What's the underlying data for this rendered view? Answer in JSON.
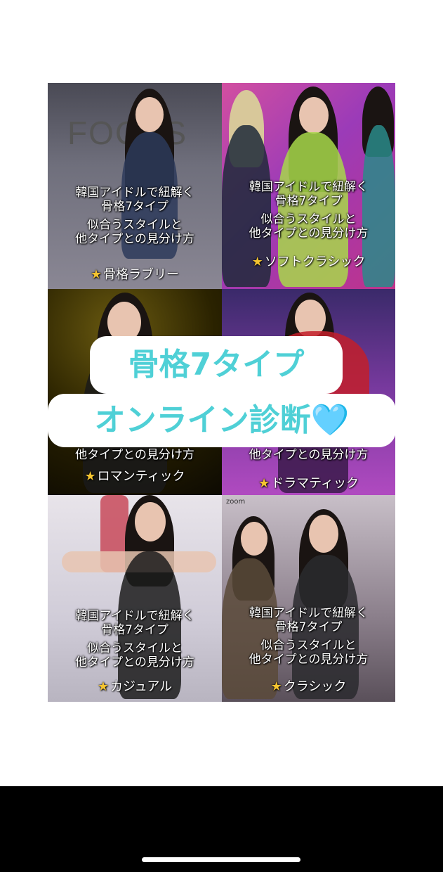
{
  "tiles": [
    {
      "caption": [
        "韓国アイドルで紐解く",
        "骨格7タイプ",
        "似合うスタイルと",
        "他タイプとの見分け方"
      ],
      "tag": "骨格ラブリー",
      "bg_logo": "FOCUS"
    },
    {
      "caption": [
        "韓国アイドルで紐解く",
        "骨格7タイプ",
        "似合うスタイルと",
        "他タイプとの見分け方"
      ],
      "tag": "ソフトクラシック"
    },
    {
      "caption_partial": "他タイプとの見分け方",
      "tag": "ロマンティック"
    },
    {
      "caption_partial": "他タイプとの見分け方",
      "tag": "ドラマティック"
    },
    {
      "caption": [
        "韓国アイドルで紐解く",
        "骨格7タイプ",
        "似合うスタイルと",
        "他タイプとの見分け方"
      ],
      "tag": "カジュアル"
    },
    {
      "caption": [
        "韓国アイドルで紐解く",
        "骨格7タイプ",
        "似合うスタイルと",
        "他タイプとの見分け方"
      ],
      "tag": "クラシック",
      "watermark": "zoom"
    }
  ],
  "banner": {
    "line1": "骨格7タイプ",
    "line2": "オンライン診断",
    "heart": "🩵"
  },
  "star_glyph": "★",
  "colors": {
    "banner_text": "#4fd0d6",
    "star": "#f4c430"
  }
}
